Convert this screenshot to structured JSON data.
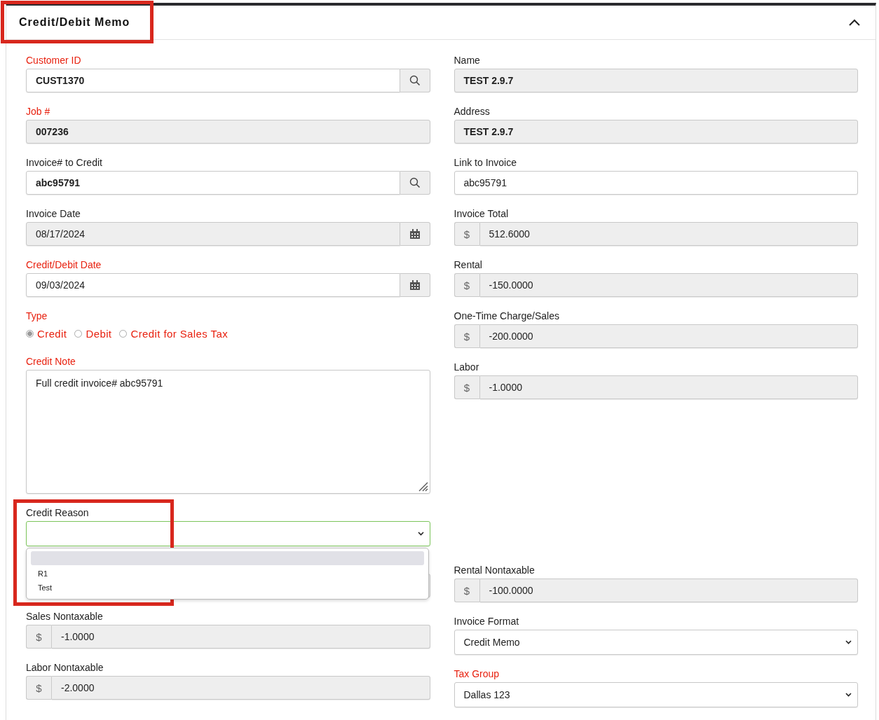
{
  "panel": {
    "title": "Credit/Debit Memo",
    "expanded": true
  },
  "left_column": [
    {
      "kind": "search",
      "label": "Customer ID",
      "required": true,
      "value": "CUST1370",
      "bold": true,
      "readonly": false
    },
    {
      "kind": "text",
      "label": "Job #",
      "required": true,
      "value": "007236",
      "bold": true,
      "readonly": true
    },
    {
      "kind": "search",
      "label": "Invoice# to Credit",
      "required": false,
      "value": "abc95791",
      "bold": true,
      "readonly": false
    },
    {
      "kind": "date",
      "label": "Invoice Date",
      "required": false,
      "value": "08/17/2024",
      "bold": false,
      "readonly": true
    },
    {
      "kind": "date",
      "label": "Credit/Debit Date",
      "required": true,
      "value": "09/03/2024",
      "bold": false,
      "readonly": false
    },
    {
      "kind": "radio",
      "label": "Type",
      "required": true,
      "options": [
        {
          "label": "Credit",
          "selected": true
        },
        {
          "label": "Debit",
          "selected": false
        },
        {
          "label": "Credit for Sales Tax",
          "selected": false
        }
      ]
    },
    {
      "kind": "textarea",
      "label": "Credit Note",
      "required": true,
      "value": "Full credit invoice# abc95791",
      "readonly": false
    },
    {
      "kind": "select",
      "label": "Credit Reason",
      "required": false,
      "focused": true,
      "open": true,
      "blank_highlighted": true,
      "options": [
        {
          "label": "R1",
          "selected": false
        },
        {
          "label": "Test",
          "selected": false
        }
      ]
    },
    {
      "kind": "covered"
    },
    {
      "kind": "currency",
      "label": "Sales Nontaxable",
      "required": false,
      "symbol": "$",
      "value": "-1.0000",
      "readonly": true
    },
    {
      "kind": "currency",
      "label": "Labor Nontaxable",
      "required": false,
      "symbol": "$",
      "value": "-2.0000",
      "readonly": true
    }
  ],
  "right_column": [
    {
      "kind": "text",
      "label": "Name",
      "required": false,
      "value": "TEST 2.9.7",
      "bold": true,
      "readonly": true
    },
    {
      "kind": "text",
      "label": "Address",
      "required": false,
      "value": "TEST 2.9.7",
      "bold": true,
      "readonly": true
    },
    {
      "kind": "text",
      "label": "Link to Invoice",
      "required": false,
      "value": "abc95791",
      "bold": false,
      "readonly": false
    },
    {
      "kind": "currency",
      "label": "Invoice Total",
      "required": false,
      "symbol": "$",
      "value": "512.6000",
      "readonly": true
    },
    {
      "kind": "currency",
      "label": "Rental",
      "required": false,
      "symbol": "$",
      "value": "-150.0000",
      "readonly": true
    },
    {
      "kind": "currency",
      "label": "One-Time Charge/Sales",
      "required": false,
      "symbol": "$",
      "value": "-200.0000",
      "readonly": true
    },
    {
      "kind": "currency",
      "label": "Labor",
      "required": false,
      "symbol": "$",
      "value": "-1.0000",
      "readonly": true
    },
    {
      "kind": "currency",
      "label": "Rental Nontaxable",
      "required": false,
      "symbol": "$",
      "value": "-100.0000",
      "readonly": true
    },
    {
      "kind": "select",
      "label": "Invoice Format",
      "required": false,
      "value": "Credit Memo",
      "focused": false
    },
    {
      "kind": "select",
      "label": "Tax Group",
      "required": true,
      "value": "Dallas 123",
      "focused": false
    }
  ]
}
